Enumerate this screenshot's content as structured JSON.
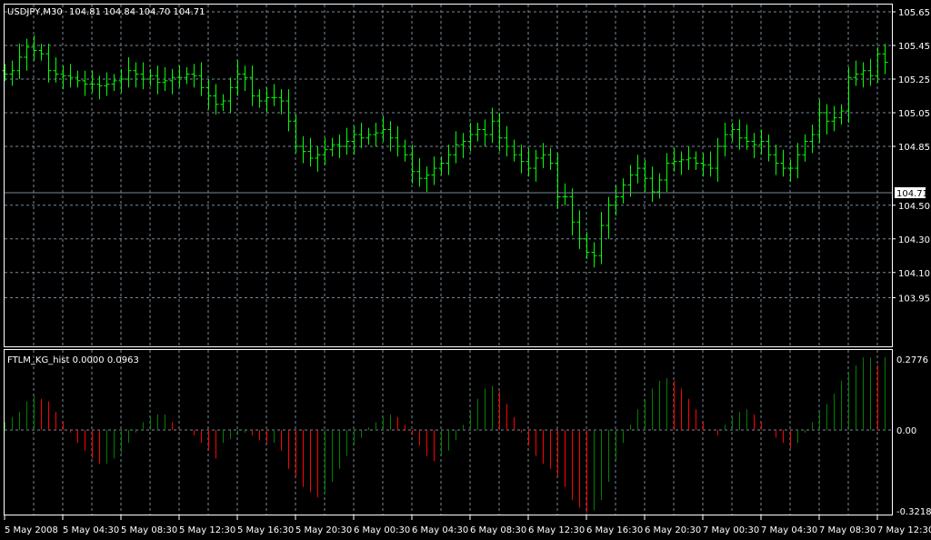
{
  "main_header": {
    "symbol": "USDJPY,M30",
    "open": "104.81",
    "high": "104.84",
    "low": "104.70",
    "close": "104.71"
  },
  "indicator_header": {
    "name": "FTLM_KG_hist",
    "value1": "0.0000",
    "value2": "0.0963"
  },
  "current_price_label": "104.71",
  "colors": {
    "bull": "#00ff00",
    "grid": "#778899",
    "hist_up": "#008000",
    "hist_down": "#ff0000",
    "frame": "#ffffff"
  },
  "chart_data": [
    {
      "type": "bar",
      "title": "USDJPY,M30",
      "y_ticks": [
        "105.65",
        "105.45",
        "105.25",
        "105.05",
        "104.85",
        "104.50",
        "104.30",
        "104.10",
        "103.95"
      ],
      "ylim": [
        103.93,
        105.67
      ],
      "closes": [
        105.28,
        105.3,
        105.38,
        105.44,
        105.42,
        105.4,
        105.3,
        105.28,
        105.27,
        105.26,
        105.24,
        105.22,
        105.22,
        105.21,
        105.22,
        105.24,
        105.25,
        105.3,
        105.28,
        105.25,
        105.27,
        105.23,
        105.24,
        105.26,
        105.26,
        105.28,
        105.27,
        105.2,
        105.15,
        105.1,
        105.12,
        105.2,
        105.28,
        105.26,
        105.15,
        105.12,
        105.14,
        105.14,
        105.12,
        105.0,
        104.85,
        104.82,
        104.78,
        104.8,
        104.83,
        104.86,
        104.85,
        104.88,
        104.92,
        104.9,
        104.92,
        104.93,
        104.95,
        104.9,
        104.85,
        104.8,
        104.7,
        104.66,
        104.68,
        104.72,
        104.75,
        104.8,
        104.86,
        104.88,
        104.92,
        104.95,
        104.92,
        105.0,
        104.9,
        104.85,
        104.8,
        104.76,
        104.72,
        104.78,
        104.8,
        104.75,
        104.55,
        104.55,
        104.4,
        104.3,
        104.22,
        104.2,
        104.38,
        104.5,
        104.55,
        104.62,
        104.68,
        104.72,
        104.66,
        104.58,
        104.65,
        104.75,
        104.76,
        104.77,
        104.78,
        104.75,
        104.74,
        104.72,
        104.85,
        104.92,
        104.95,
        104.9,
        104.88,
        104.86,
        104.88,
        104.8,
        104.75,
        104.72,
        104.72,
        104.8,
        104.88,
        104.92,
        105.05,
        105.0,
        105.02,
        105.06,
        105.26,
        105.28,
        105.3,
        105.27,
        105.4,
        105.35
      ]
    },
    {
      "type": "bar",
      "title": "FTLM_KG_hist",
      "y_ticks": [
        "0.2776",
        "0.00",
        "-0.3218"
      ],
      "ylim": [
        -0.3218,
        0.2776
      ],
      "values": [
        0.03,
        0.05,
        0.07,
        0.11,
        0.13,
        0.12,
        0.11,
        0.07,
        0.03,
        -0.01,
        -0.05,
        -0.08,
        -0.11,
        -0.13,
        -0.13,
        -0.11,
        -0.09,
        -0.05,
        -0.01,
        0.03,
        0.05,
        0.06,
        0.06,
        0.03,
        0.005,
        0,
        -0.02,
        -0.05,
        -0.08,
        -0.11,
        -0.05,
        -0.035,
        -0.02,
        -0.01,
        -0.02,
        -0.04,
        -0.05,
        -0.05,
        -0.08,
        -0.15,
        -0.18,
        -0.22,
        -0.24,
        -0.26,
        -0.24,
        -0.2,
        -0.15,
        -0.1,
        -0.06,
        -0.03,
        0.01,
        0.03,
        0.05,
        0.06,
        0.05,
        0.02,
        -0.02,
        -0.06,
        -0.1,
        -0.12,
        -0.1,
        -0.08,
        -0.04,
        0.02,
        0.07,
        0.12,
        0.16,
        0.17,
        0.15,
        0.1,
        0.05,
        -0.01,
        -0.06,
        -0.1,
        -0.13,
        -0.15,
        -0.18,
        -0.22,
        -0.27,
        -0.3,
        -0.32,
        -0.31,
        -0.27,
        -0.2,
        -0.12,
        -0.05,
        0.02,
        0.08,
        0.12,
        0.16,
        0.19,
        0.2,
        0.19,
        0.16,
        0.12,
        0.08,
        0.03,
        0.0,
        -0.02,
        0.02,
        0.05,
        0.07,
        0.08,
        0.06,
        0.03,
        0.0,
        -0.03,
        -0.05,
        -0.07,
        -0.05,
        -0.01,
        0.03,
        0.07,
        0.1,
        0.14,
        0.19,
        0.22,
        0.25,
        0.28,
        0.28,
        0.25,
        0.28
      ]
    }
  ],
  "x_ticks": [
    "5 May 2008",
    "5 May 04:30",
    "5 May 08:30",
    "5 May 12:30",
    "5 May 16:30",
    "5 May 20:30",
    "6 May 00:30",
    "6 May 04:30",
    "6 May 08:30",
    "6 May 12:30",
    "6 May 16:30",
    "6 May 20:30",
    "7 May 00:30",
    "7 May 04:30",
    "7 May 08:30",
    "7 May 12:30"
  ]
}
